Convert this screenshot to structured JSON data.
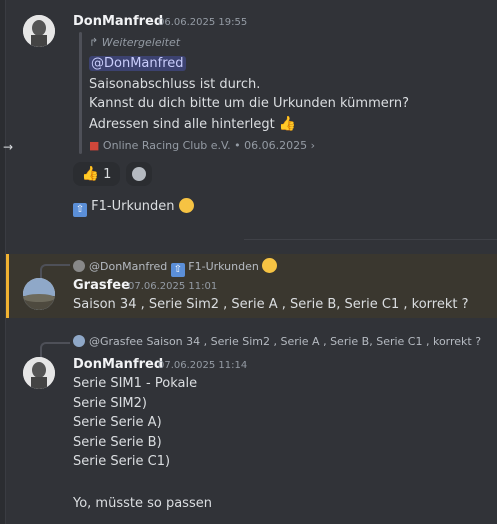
{
  "colors": {
    "background": "#313338",
    "accent": "#f0b232",
    "mention_bg": "#3c4270"
  },
  "message1": {
    "author": "DonManfred",
    "timestamp": "06.06.2025 19:55",
    "forwarded_label": "Weitergeleitet",
    "forwarded_mention": "@DonManfred",
    "forwarded_lines": [
      "Saisonabschluss ist durch.",
      "Kannst du dich bitte um die Urkunden kümmern?",
      "Adressen sind alle hinterlegt"
    ],
    "source": "Online Racing Club e.V.",
    "source_sep": "•",
    "source_date": "06.06.2025",
    "reaction_count": "1",
    "body": "F1-Urkunden"
  },
  "message2": {
    "reply_to_author": "@DonManfred",
    "reply_to_text": "F1-Urkunden",
    "author": "Grasfee",
    "timestamp": "07.06.2025 11:01",
    "body": "Saison 34 , Serie Sim2 , Serie A , Serie B, Serie C1 , korrekt ?"
  },
  "message3": {
    "reply_to_author": "@Grasfee",
    "reply_to_text": "Saison 34 , Serie Sim2 , Serie A , Serie B, Serie C1 , korrekt ?",
    "author": "DonManfred",
    "timestamp": "07.06.2025 11:14",
    "lines": [
      "Serie SIM1 - Pokale",
      "Serie SIM2)",
      "Serie Serie A)",
      "Serie Serie B)",
      "Serie Serie C1)",
      "",
      "Yo, müsste so passen"
    ]
  }
}
